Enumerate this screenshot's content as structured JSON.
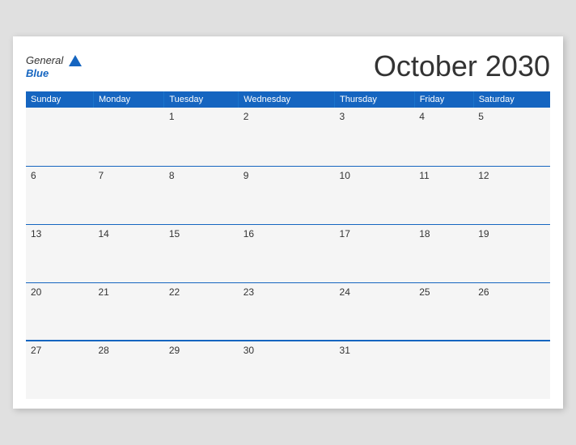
{
  "header": {
    "logo_general": "General",
    "logo_blue": "Blue",
    "month_title": "October 2030"
  },
  "weekdays": [
    "Sunday",
    "Monday",
    "Tuesday",
    "Wednesday",
    "Thursday",
    "Friday",
    "Saturday"
  ],
  "weeks": [
    [
      "",
      "",
      "1",
      "2",
      "3",
      "4",
      "5"
    ],
    [
      "6",
      "7",
      "8",
      "9",
      "10",
      "11",
      "12"
    ],
    [
      "13",
      "14",
      "15",
      "16",
      "17",
      "18",
      "19"
    ],
    [
      "20",
      "21",
      "22",
      "23",
      "24",
      "25",
      "26"
    ],
    [
      "27",
      "28",
      "29",
      "30",
      "31",
      "",
      ""
    ]
  ]
}
